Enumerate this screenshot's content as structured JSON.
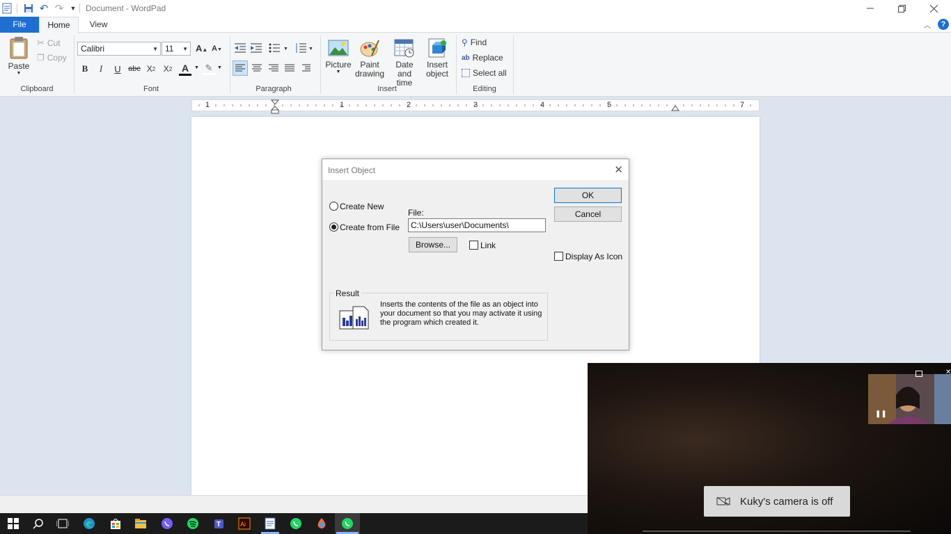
{
  "window": {
    "title": "Document - WordPad"
  },
  "tabs": {
    "file": "File",
    "home": "Home",
    "view": "View"
  },
  "clipboard": {
    "paste": "Paste",
    "cut": "Cut",
    "copy": "Copy",
    "group": "Clipboard"
  },
  "font": {
    "name": "Calibri",
    "size": "11",
    "group": "Font"
  },
  "paragraph": {
    "group": "Paragraph"
  },
  "insert": {
    "picture": "Picture",
    "paint_1": "Paint",
    "paint_2": "drawing",
    "date_1": "Date and",
    "date_2": "time",
    "object_1": "Insert",
    "object_2": "object",
    "group": "Insert"
  },
  "editing": {
    "find": "Find",
    "replace": "Replace",
    "select_all": "Select all",
    "group": "Editing"
  },
  "ruler": {
    "ticks": [
      "1",
      "1",
      "2",
      "3",
      "4",
      "5",
      "7"
    ]
  },
  "dialog": {
    "title": "Insert Object",
    "create_new": "Create New",
    "create_from_file": "Create from File",
    "file_label": "File:",
    "file_path": "C:\\Users\\user\\Documents\\",
    "browse": "Browse...",
    "link": "Link",
    "display_as_icon": "Display As Icon",
    "ok": "OK",
    "cancel": "Cancel",
    "result_label": "Result",
    "result_line1": "Inserts the contents of the file as an object into",
    "result_line2": "your document so that you may activate it using",
    "result_line3": "the program which created it."
  },
  "video": {
    "camera_off": "Kuky's camera is off"
  },
  "taskbar_icons": [
    "windows-icon",
    "search-icon",
    "task-view-icon",
    "edge-icon",
    "store-icon",
    "explorer-icon",
    "viber-icon",
    "spotify-icon",
    "teams-icon",
    "illustrator-icon",
    "wordpad-icon",
    "whatsapp-icon",
    "paint3d-icon",
    "whatsapp-active-icon"
  ]
}
